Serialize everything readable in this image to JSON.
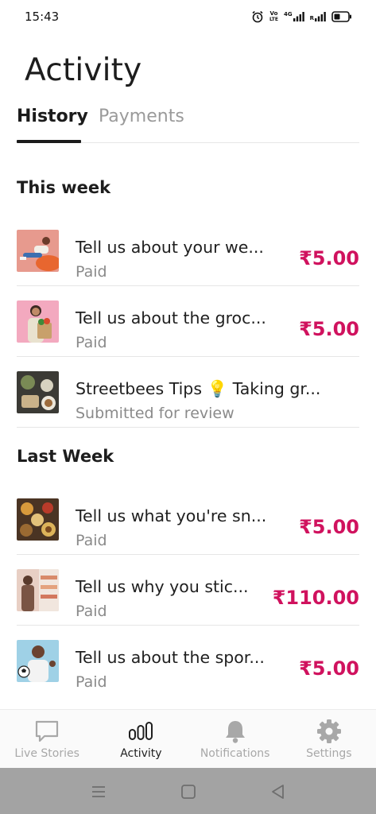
{
  "status_bar": {
    "time": "15:43",
    "volte_top": "Vo",
    "volte_bottom": "LTE",
    "network": "4G",
    "roaming": "R",
    "icons": [
      "alarm-icon",
      "volte-icon",
      "signal-4g-icon",
      "signal-r-icon",
      "battery-icon"
    ]
  },
  "header": {
    "title": "Activity"
  },
  "tabs": [
    {
      "label": "History",
      "active": true
    },
    {
      "label": "Payments",
      "active": false
    }
  ],
  "sections": [
    {
      "heading": "This week",
      "items": [
        {
          "title": "Tell us about your we...",
          "status": "Paid",
          "amount": "₹5.00",
          "thumb": "person-on-orange-thumbnail"
        },
        {
          "title": "Tell us about the groc...",
          "status": "Paid",
          "amount": "₹5.00",
          "thumb": "grocery-bag-thumbnail"
        },
        {
          "title": "Streetbees Tips 💡 Taking gr...",
          "status": "Submitted for review",
          "amount": "",
          "thumb": "food-photo-thumbnail"
        }
      ]
    },
    {
      "heading": "Last Week",
      "items": [
        {
          "title": "Tell us what you're sn...",
          "status": "Paid",
          "amount": "₹5.00",
          "thumb": "snacks-thumbnail"
        },
        {
          "title": "Tell us why you stic...",
          "status": "Paid",
          "amount": "₹110.00",
          "thumb": "store-shelf-thumbnail"
        },
        {
          "title": "Tell us about the spor...",
          "status": "Paid",
          "amount": "₹5.00",
          "thumb": "football-player-thumbnail"
        }
      ]
    }
  ],
  "bottom_nav": [
    {
      "label": "Live Stories",
      "icon": "chat-bubble-icon",
      "active": false
    },
    {
      "label": "Activity",
      "icon": "bar-chart-icon",
      "active": true
    },
    {
      "label": "Notifications",
      "icon": "bell-icon",
      "active": false
    },
    {
      "label": "Settings",
      "icon": "gear-icon",
      "active": false
    }
  ],
  "system_nav": {
    "icons": [
      "menu-icon",
      "home-icon",
      "back-icon"
    ]
  },
  "colors": {
    "accent": "#d0125e",
    "text": "#1f1f1f",
    "muted": "#8a8a8a",
    "system_nav": "#a3a3a3"
  }
}
